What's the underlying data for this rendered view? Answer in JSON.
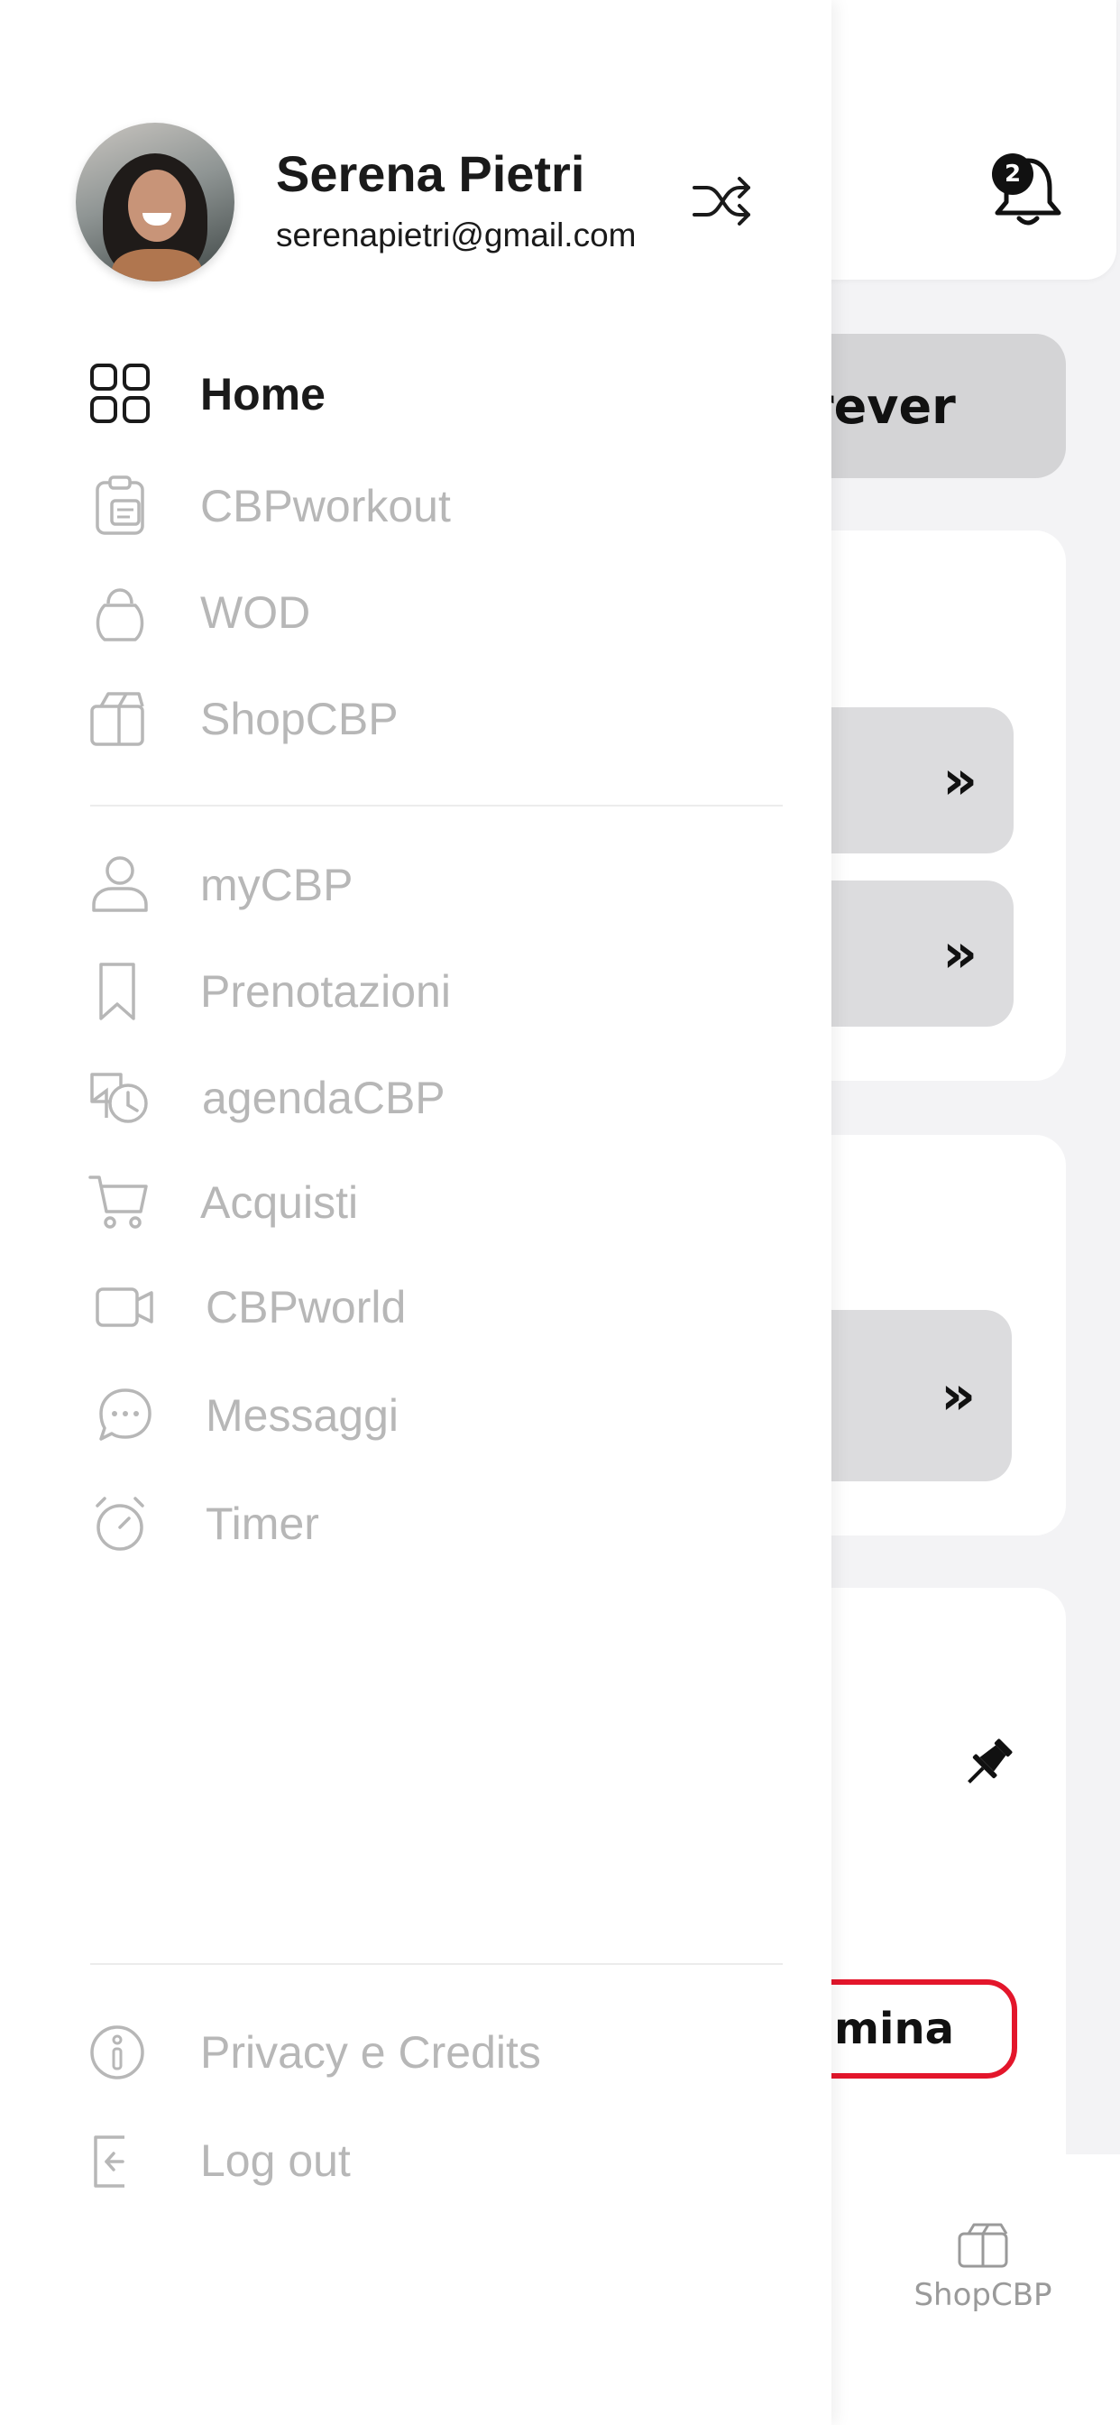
{
  "user": {
    "name": "Serena Pietri",
    "email": "serenapietri@gmail.com"
  },
  "notifications": {
    "count": "2"
  },
  "menu": {
    "main": [
      {
        "label": "Home",
        "icon": "grid-icon",
        "active": true
      },
      {
        "label": "CBPworkout",
        "icon": "clipboard-icon",
        "active": false
      },
      {
        "label": "WOD",
        "icon": "kettlebell-icon",
        "active": false
      },
      {
        "label": "ShopCBP",
        "icon": "shopping-bag-icon",
        "active": false
      }
    ],
    "secondary": [
      {
        "label": "myCBP",
        "icon": "user-icon"
      },
      {
        "label": "Prenotazioni",
        "icon": "bookmark-icon"
      },
      {
        "label": "agendaCBP",
        "icon": "calendar-history-icon"
      },
      {
        "label": "Acquisti",
        "icon": "cart-icon"
      },
      {
        "label": "CBPworld",
        "icon": "video-icon"
      },
      {
        "label": "Messaggi",
        "icon": "chat-icon"
      },
      {
        "label": "Timer",
        "icon": "stopwatch-icon"
      }
    ],
    "footer": [
      {
        "label": "Privacy e Credits",
        "icon": "info-icon"
      },
      {
        "label": "Log out",
        "icon": "logout-icon"
      }
    ]
  },
  "background": {
    "pill_text": "rever",
    "delete_label": "limina",
    "bottom_nav_label": "ShopCBP"
  },
  "colors": {
    "accent_red": "#e3162b",
    "text_dark": "#1a1a1a",
    "text_muted": "#b7b7b7"
  }
}
